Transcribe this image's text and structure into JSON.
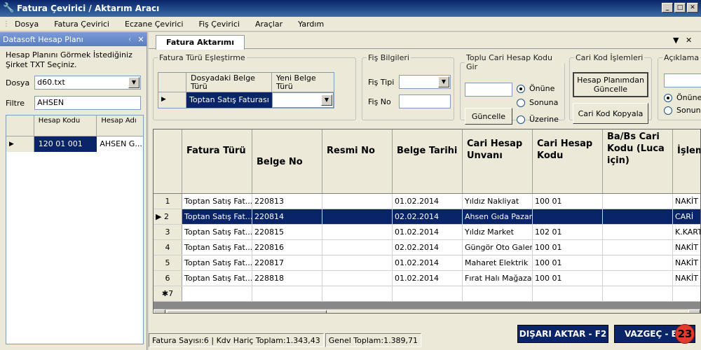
{
  "window": {
    "title": "Fatura Çevirici / Aktarım Aracı",
    "minimize": "_",
    "maximize": "□",
    "close": "✕"
  },
  "menu": [
    "Dosya",
    "Fatura Çevirici",
    "Eczane Çevirici",
    "Fiş Çevirici",
    "Araçlar",
    "Yardım"
  ],
  "left_panel": {
    "title": "Datasoft Hesap Planı",
    "description": "Hesap Planını Görmek İstediğiniz Şirket TXT Seçiniz.",
    "file_label": "Dosya",
    "file_value": "d60.txt",
    "filter_label": "Filtre",
    "filter_value": "AHSEN",
    "grid_headers": [
      "Hesap Kodu",
      "Hesap Adı"
    ],
    "grid_row": [
      "120 01 001",
      "AHSEN G..."
    ]
  },
  "tab": {
    "label": "Fatura Aktarımı"
  },
  "fatura_turu": {
    "legend": "Fatura Türü Eşleştirme",
    "headers": [
      "Dosyadaki Belge Türü",
      "Yeni Belge Türü"
    ],
    "row": "Toptan Satış Faturası"
  },
  "fis_bilgileri": {
    "legend": "Fiş Bilgileri",
    "tipi_label": "Fiş Tipi",
    "no_label": "Fiş No"
  },
  "toplu_cari": {
    "legend": "Toplu Cari Hesap Kodu Gir",
    "update_button": "Güncelle",
    "radio": [
      "Önüne",
      "Sonuna",
      "Üzerine"
    ]
  },
  "cari_kod": {
    "legend": "Cari Kod İşlemleri",
    "btn_update": "Hesap Planımdan Güncelle",
    "btn_copy": "Cari Kod Kopyala"
  },
  "aciklama": {
    "legend": "Açıklama",
    "radio": [
      "Önüne",
      "Sonun"
    ]
  },
  "grid": {
    "headers": [
      "Fatura Türü",
      "Belge No",
      "Resmi No",
      "Belge Tarihi",
      "Cari Hesap Unvanı",
      "Cari Hesap Kodu",
      "Ba/Bs Cari Kodu (Luca için)",
      "İşlem Döv"
    ],
    "rows": [
      {
        "n": "1",
        "cells": [
          "Toptan Satış Fat...",
          "220813",
          "",
          "01.02.2014",
          "Yıldız Nakliyat",
          "100 01",
          "",
          "NAKİT"
        ]
      },
      {
        "n": "2",
        "cells": [
          "Toptan Satış Fat...",
          "220814",
          "",
          "02.02.2014",
          "Ahsen Gıda Pazarı",
          "",
          "",
          "CARİ"
        ]
      },
      {
        "n": "3",
        "cells": [
          "Toptan Satış Fat...",
          "220815",
          "",
          "01.02.2014",
          "Yıldız Market",
          "102 01",
          "",
          "K.KART"
        ]
      },
      {
        "n": "4",
        "cells": [
          "Toptan Satış Fat...",
          "220816",
          "",
          "02.02.2014",
          "Güngör Oto Galeri",
          "100 01",
          "",
          "NAKİT"
        ]
      },
      {
        "n": "5",
        "cells": [
          "Toptan Satış Fat...",
          "220817",
          "",
          "01.02.2014",
          "Maharet Elektrik",
          "100 01",
          "",
          "NAKİT"
        ]
      },
      {
        "n": "6",
        "cells": [
          "Toptan Satış Fat...",
          "228818",
          "",
          "01.02.2014",
          "Fırat Halı Mağazası",
          "100 01",
          "",
          "NAKİT"
        ]
      },
      {
        "n": "✱7",
        "cells": [
          "",
          "",
          "",
          "",
          "",
          "",
          "",
          ""
        ]
      }
    ]
  },
  "status": {
    "count": "Fatura Sayısı:6",
    "kdv": "Kdv Hariç Toplam:1.343,43",
    "total": "Genel Toplam:1.389,71"
  },
  "buttons": {
    "export": "DIŞARI AKTAR - F2",
    "cancel": "VAZGEÇ - ES"
  },
  "badge": "23"
}
